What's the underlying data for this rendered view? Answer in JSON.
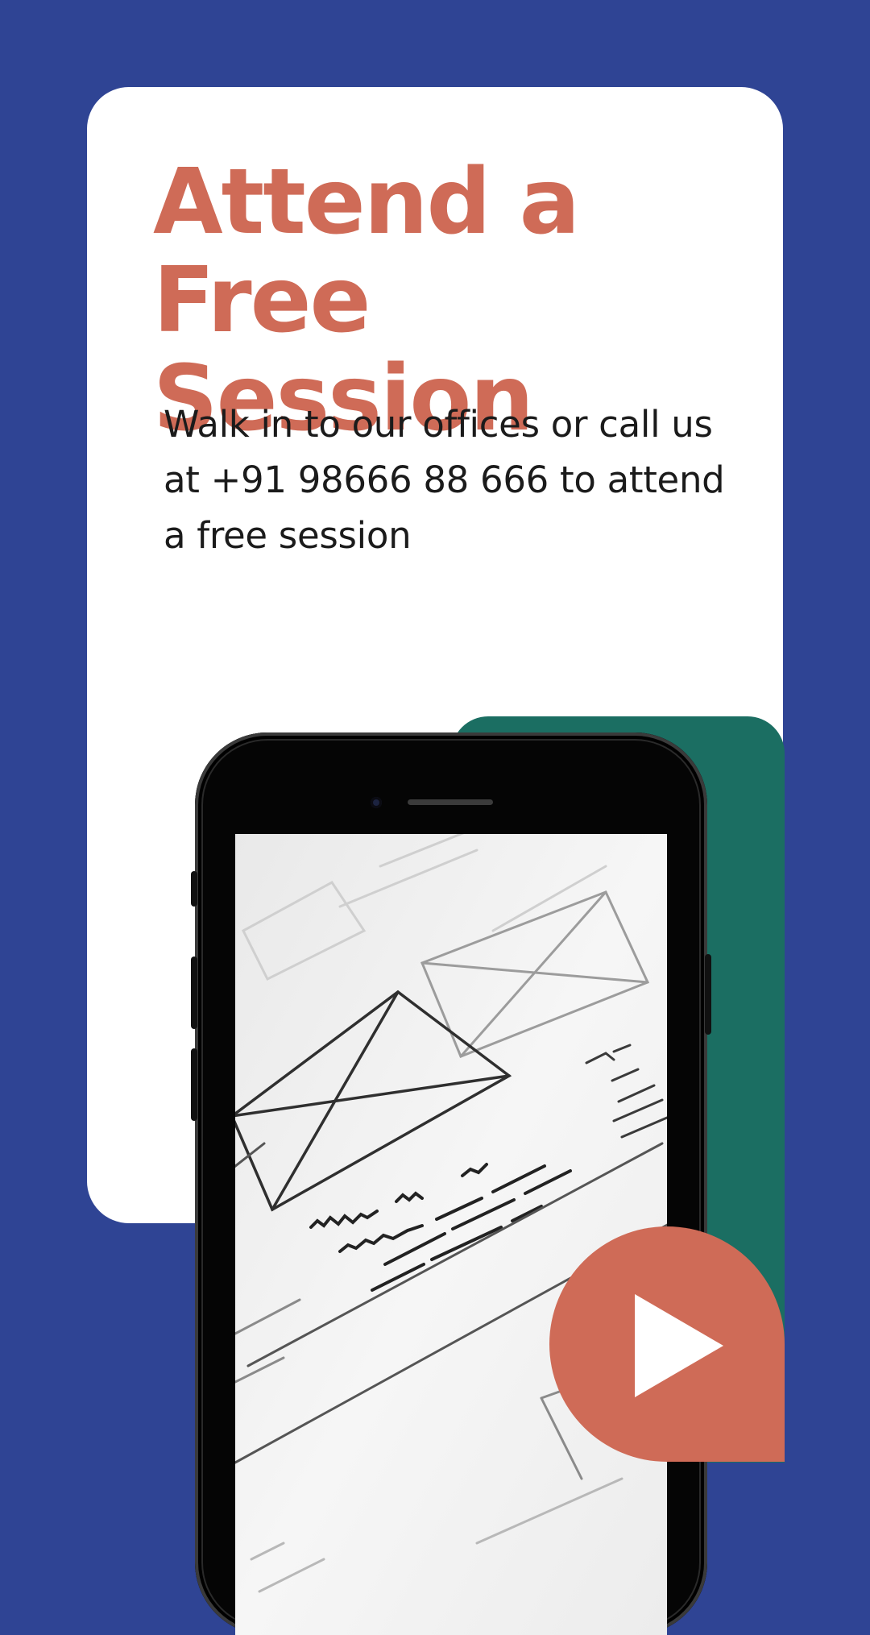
{
  "headline": {
    "line1": "Attend a",
    "line2": "Free Session"
  },
  "description": "Walk in to our offices or call us at +91 98666 88 666 to attend a free session",
  "icons": {
    "play": "play-icon",
    "camera": "front-camera-icon"
  },
  "colors": {
    "background": "#2f4494",
    "card": "#ffffff",
    "accent": "#cf6b57",
    "teal": "#1b6e62",
    "text": "#1b1b1b"
  }
}
